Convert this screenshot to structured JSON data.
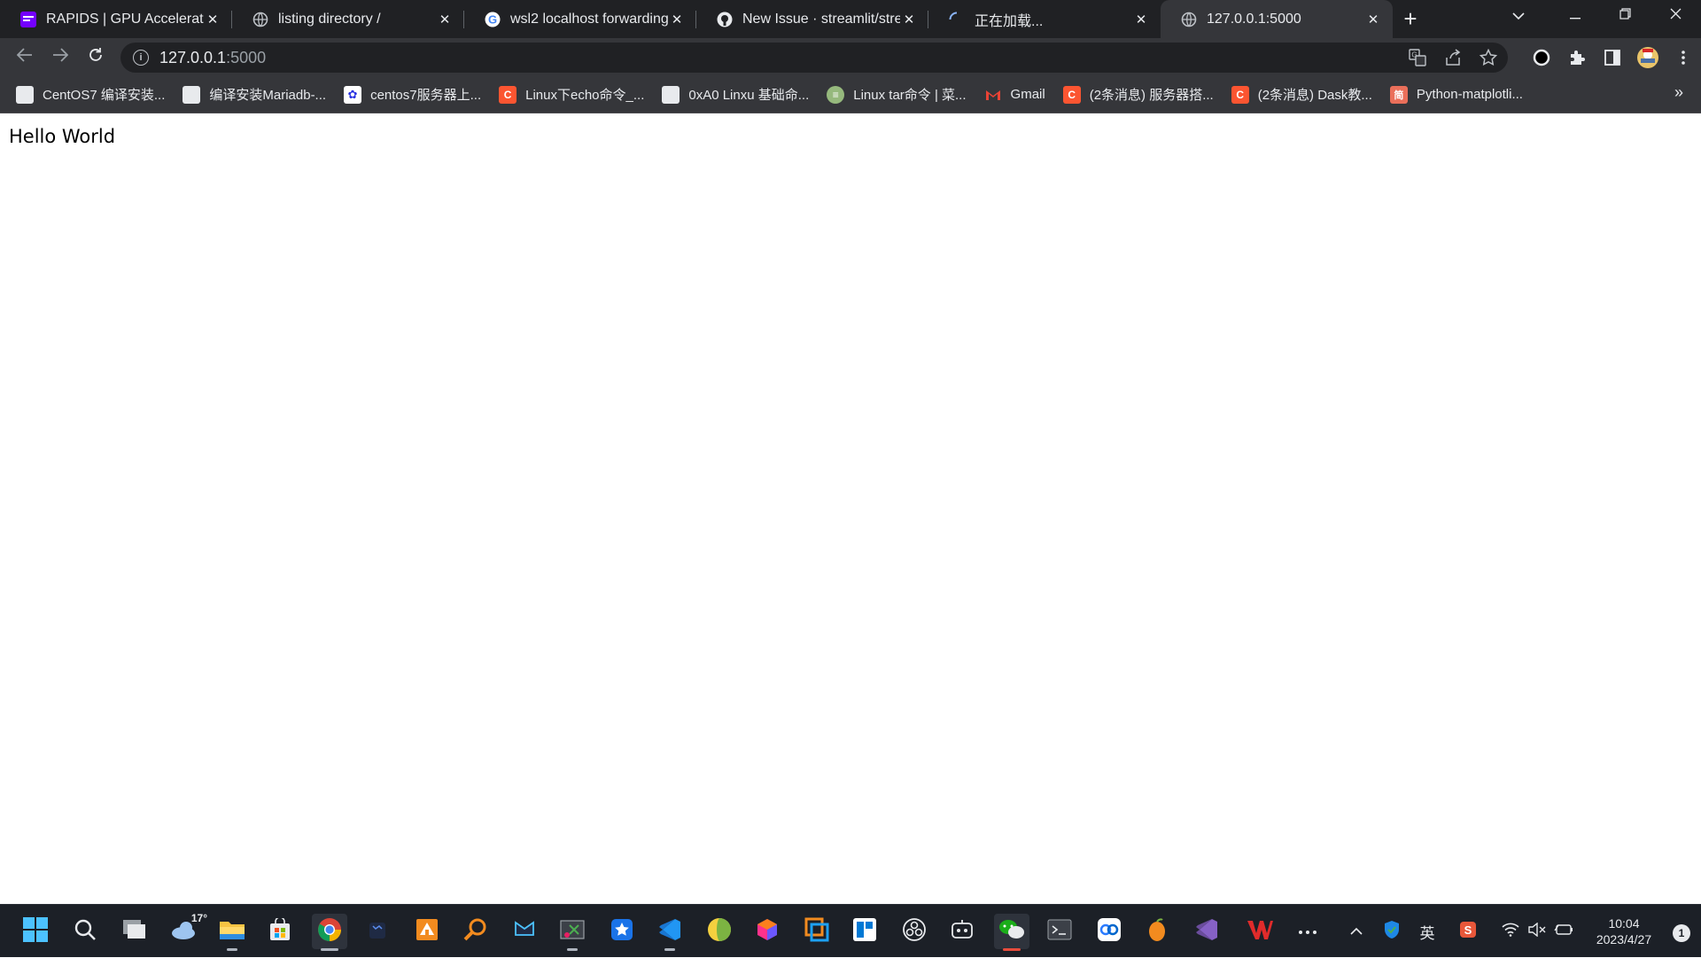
{
  "browser": {
    "tabs": [
      {
        "title": "RAPIDS | GPU Accelerated",
        "favicon": "rapids-icon",
        "active": false
      },
      {
        "title": "listing directory /",
        "favicon": "globe-icon",
        "active": false
      },
      {
        "title": "wsl2 localhost forwarding",
        "favicon": "google-icon",
        "active": false
      },
      {
        "title": "New Issue · streamlit/stre",
        "favicon": "github-icon",
        "active": false
      },
      {
        "title": "正在加载...",
        "favicon": "loading-spinner-icon",
        "active": false
      },
      {
        "title": "127.0.0.1:5000",
        "favicon": "globe-icon",
        "active": true
      }
    ],
    "url_host": "127.0.0.1",
    "url_rest": ":5000",
    "bookmarks": [
      {
        "label": "CentOS7 编译安装...",
        "icon": "page-icon"
      },
      {
        "label": "编译安装Mariadb-...",
        "icon": "page-icon"
      },
      {
        "label": "centos7服务器上...",
        "icon": "baidu-icon"
      },
      {
        "label": "Linux下echo命令_...",
        "icon": "csdn-icon"
      },
      {
        "label": "0xA0 Linxu 基础命...",
        "icon": "page-icon"
      },
      {
        "label": "Linux tar命令 | 菜...",
        "icon": "runoob-icon"
      },
      {
        "label": "Gmail",
        "icon": "gmail-icon"
      },
      {
        "label": "(2条消息) 服务器搭...",
        "icon": "csdn-icon"
      },
      {
        "label": "(2条消息) Dask教...",
        "icon": "csdn-icon"
      },
      {
        "label": "Python-matplotli...",
        "icon": "jianshu-icon"
      }
    ],
    "bookmarks_overflow": "»"
  },
  "page": {
    "text": "Hello World"
  },
  "taskbar": {
    "weather_temp": "17°",
    "tray_ime": "英",
    "time": "10:04",
    "date": "2023/4/27",
    "notification_count": "1"
  },
  "colors": {
    "tab_strip": "#202124",
    "toolbar": "#35363a",
    "taskbar": "#1c2027",
    "csdn_red": "#fc5531",
    "rapids_purple": "#7400ff"
  }
}
